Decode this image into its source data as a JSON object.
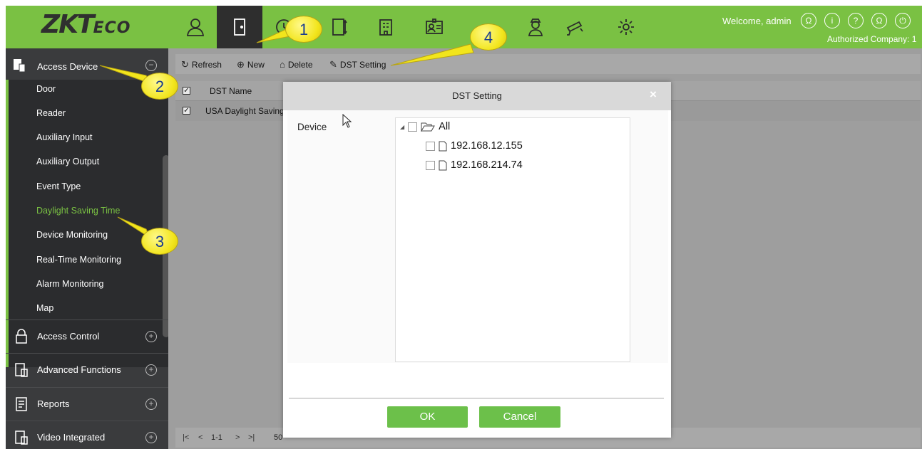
{
  "header": {
    "logo_main": "ZKT",
    "logo_suffix": "ECO",
    "welcome": "Welcome, admin",
    "company": "Authorized Company: 1"
  },
  "nav_icons": [
    "personnel-icon",
    "access-door-icon",
    "attendance-icon",
    "elevator-icon",
    "building-icon",
    "visitor-card-icon",
    "guard-icon",
    "camera-icon",
    "settings-icon"
  ],
  "sidebar": {
    "section_title": "Access Device",
    "items": [
      {
        "label": "Door"
      },
      {
        "label": "Reader"
      },
      {
        "label": "Auxiliary Input"
      },
      {
        "label": "Auxiliary Output"
      },
      {
        "label": "Event Type"
      },
      {
        "label": "Daylight Saving Time"
      },
      {
        "label": "Device Monitoring"
      },
      {
        "label": "Real-Time Monitoring"
      },
      {
        "label": "Alarm Monitoring"
      },
      {
        "label": "Map"
      }
    ],
    "groups": [
      {
        "label": "Access Control"
      },
      {
        "label": "Advanced Functions"
      },
      {
        "label": "Reports"
      },
      {
        "label": "Video Integrated"
      }
    ]
  },
  "toolbar": {
    "refresh": "Refresh",
    "new": "New",
    "delete": "Delete",
    "dst_setting": "DST Setting"
  },
  "grid": {
    "col_name": "DST Name",
    "rows": [
      {
        "name": "USA Daylight Saving"
      }
    ]
  },
  "pager": {
    "range": "1-1",
    "per_page": "50"
  },
  "dialog": {
    "title": "DST Setting",
    "close": "×",
    "device_label": "Device",
    "tree_root": "All",
    "devices": [
      "192.168.12.155",
      "192.168.214.74"
    ],
    "ok": "OK",
    "cancel": "Cancel"
  },
  "callouts": [
    "1",
    "2",
    "3",
    "4"
  ]
}
